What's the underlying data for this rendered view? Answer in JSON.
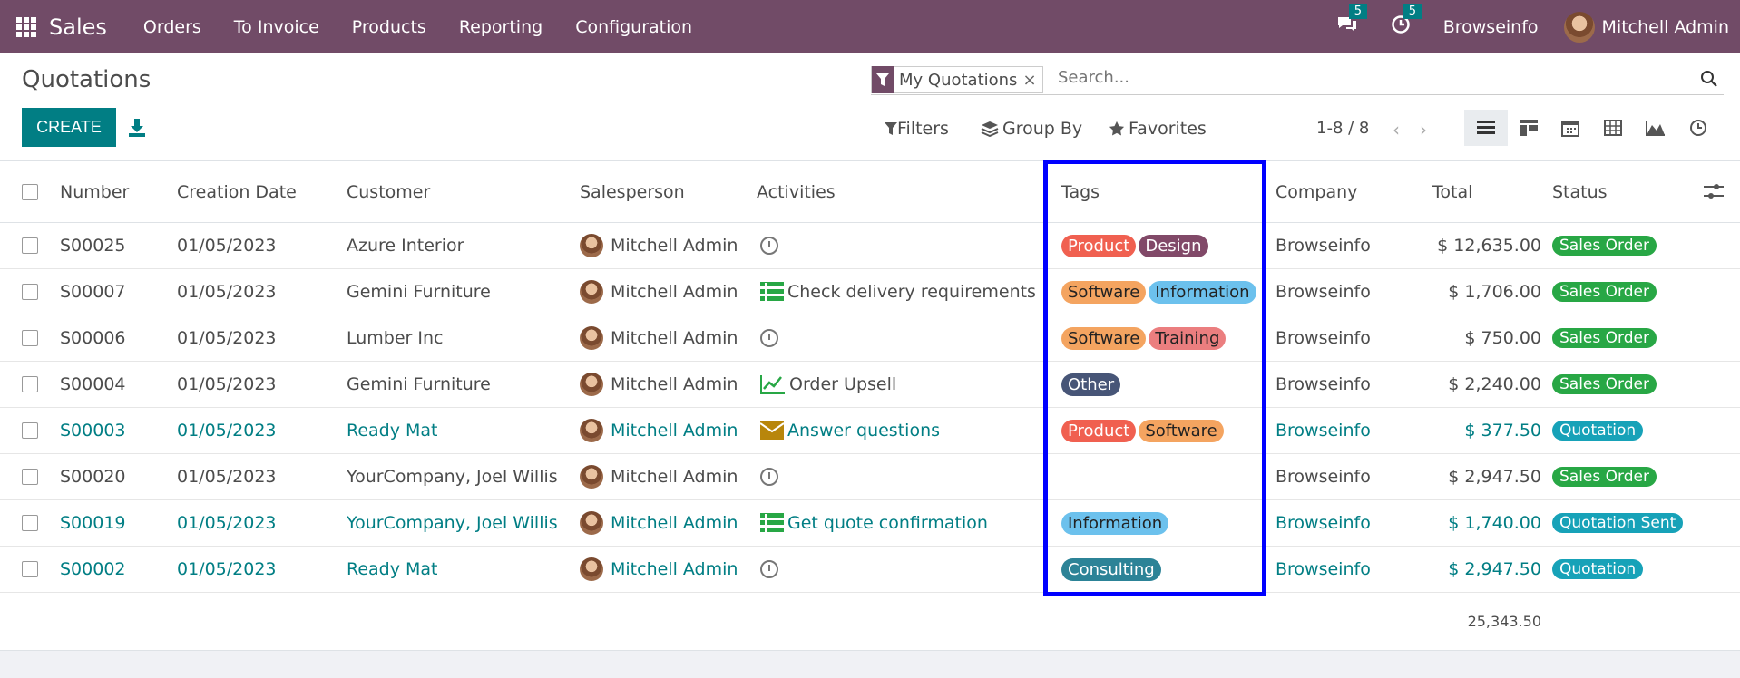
{
  "topbar": {
    "app_title": "Sales",
    "menu": [
      "Orders",
      "To Invoice",
      "Products",
      "Reporting",
      "Configuration"
    ],
    "messages_count": "5",
    "activities_count": "5",
    "company": "Browseinfo",
    "user": "Mitchell Admin",
    "bar_color": "#714B67"
  },
  "control": {
    "title": "Quotations",
    "create_label": "CREATE",
    "facet_label": "My Quotations",
    "facet_close": "×",
    "search_placeholder": "Search...",
    "filters_label": "Filters",
    "groupby_label": "Group By",
    "favorites_label": "Favorites",
    "pager": "1-8 / 8"
  },
  "table": {
    "headers": {
      "number": "Number",
      "creation_date": "Creation Date",
      "customer": "Customer",
      "salesperson": "Salesperson",
      "activities": "Activities",
      "tags": "Tags",
      "company": "Company",
      "total": "Total",
      "status": "Status"
    },
    "rows": [
      {
        "number": "S00025",
        "date": "01/05/2023",
        "customer": "Azure Interior",
        "salesperson": "Mitchell Admin",
        "activity_icon": "clock-icon",
        "activity": "",
        "tags": [
          {
            "label": "Product",
            "color": "#f06050"
          },
          {
            "label": "Design",
            "color": "#814968"
          }
        ],
        "company": "Browseinfo",
        "total": "$ 12,635.00",
        "status": "Sales Order",
        "status_color": "#28a745",
        "link": false
      },
      {
        "number": "S00007",
        "date": "01/05/2023",
        "customer": "Gemini Furniture",
        "salesperson": "Mitchell Admin",
        "activity_icon": "list-icon",
        "activity": "Check delivery requirements",
        "tags": [
          {
            "label": "Software",
            "color": "#f4a460"
          },
          {
            "label": "Information",
            "color": "#6cc1ed"
          }
        ],
        "company": "Browseinfo",
        "total": "$ 1,706.00",
        "status": "Sales Order",
        "status_color": "#28a745",
        "link": false
      },
      {
        "number": "S00006",
        "date": "01/05/2023",
        "customer": "Lumber Inc",
        "salesperson": "Mitchell Admin",
        "activity_icon": "clock-icon",
        "activity": "",
        "tags": [
          {
            "label": "Software",
            "color": "#f4a460"
          },
          {
            "label": "Training",
            "color": "#eb7e7f"
          }
        ],
        "company": "Browseinfo",
        "total": "$ 750.00",
        "status": "Sales Order",
        "status_color": "#28a745",
        "link": false
      },
      {
        "number": "S00004",
        "date": "01/05/2023",
        "customer": "Gemini Furniture",
        "salesperson": "Mitchell Admin",
        "activity_icon": "chart-icon",
        "activity": "Order Upsell",
        "tags": [
          {
            "label": "Other",
            "color": "#475577"
          }
        ],
        "company": "Browseinfo",
        "total": "$ 2,240.00",
        "status": "Sales Order",
        "status_color": "#28a745",
        "link": false
      },
      {
        "number": "S00003",
        "date": "01/05/2023",
        "customer": "Ready Mat",
        "salesperson": "Mitchell Admin",
        "activity_icon": "envelope-icon",
        "activity": "Answer questions",
        "tags": [
          {
            "label": "Product",
            "color": "#f06050"
          },
          {
            "label": "Software",
            "color": "#f4a460"
          }
        ],
        "company": "Browseinfo",
        "total": "$ 377.50",
        "status": "Quotation",
        "status_color": "#17a2b8",
        "link": true
      },
      {
        "number": "S00020",
        "date": "01/05/2023",
        "customer": "YourCompany, Joel Willis",
        "salesperson": "Mitchell Admin",
        "activity_icon": "clock-icon",
        "activity": "",
        "tags": [],
        "company": "Browseinfo",
        "total": "$ 2,947.50",
        "status": "Sales Order",
        "status_color": "#28a745",
        "link": false
      },
      {
        "number": "S00019",
        "date": "01/05/2023",
        "customer": "YourCompany, Joel Willis",
        "salesperson": "Mitchell Admin",
        "activity_icon": "list-icon",
        "activity": "Get quote confirmation",
        "tags": [
          {
            "label": "Information",
            "color": "#6cc1ed"
          }
        ],
        "company": "Browseinfo",
        "total": "$ 1,740.00",
        "status": "Quotation Sent",
        "status_color": "#17a2b8",
        "link": true
      },
      {
        "number": "S00002",
        "date": "01/05/2023",
        "customer": "Ready Mat",
        "salesperson": "Mitchell Admin",
        "activity_icon": "clock-icon",
        "activity": "",
        "tags": [
          {
            "label": "Consulting",
            "color": "#2c8397"
          }
        ],
        "company": "Browseinfo",
        "total": "$ 2,947.50",
        "status": "Quotation",
        "status_color": "#17a2b8",
        "link": true
      }
    ],
    "sum_total": "25,343.50"
  }
}
